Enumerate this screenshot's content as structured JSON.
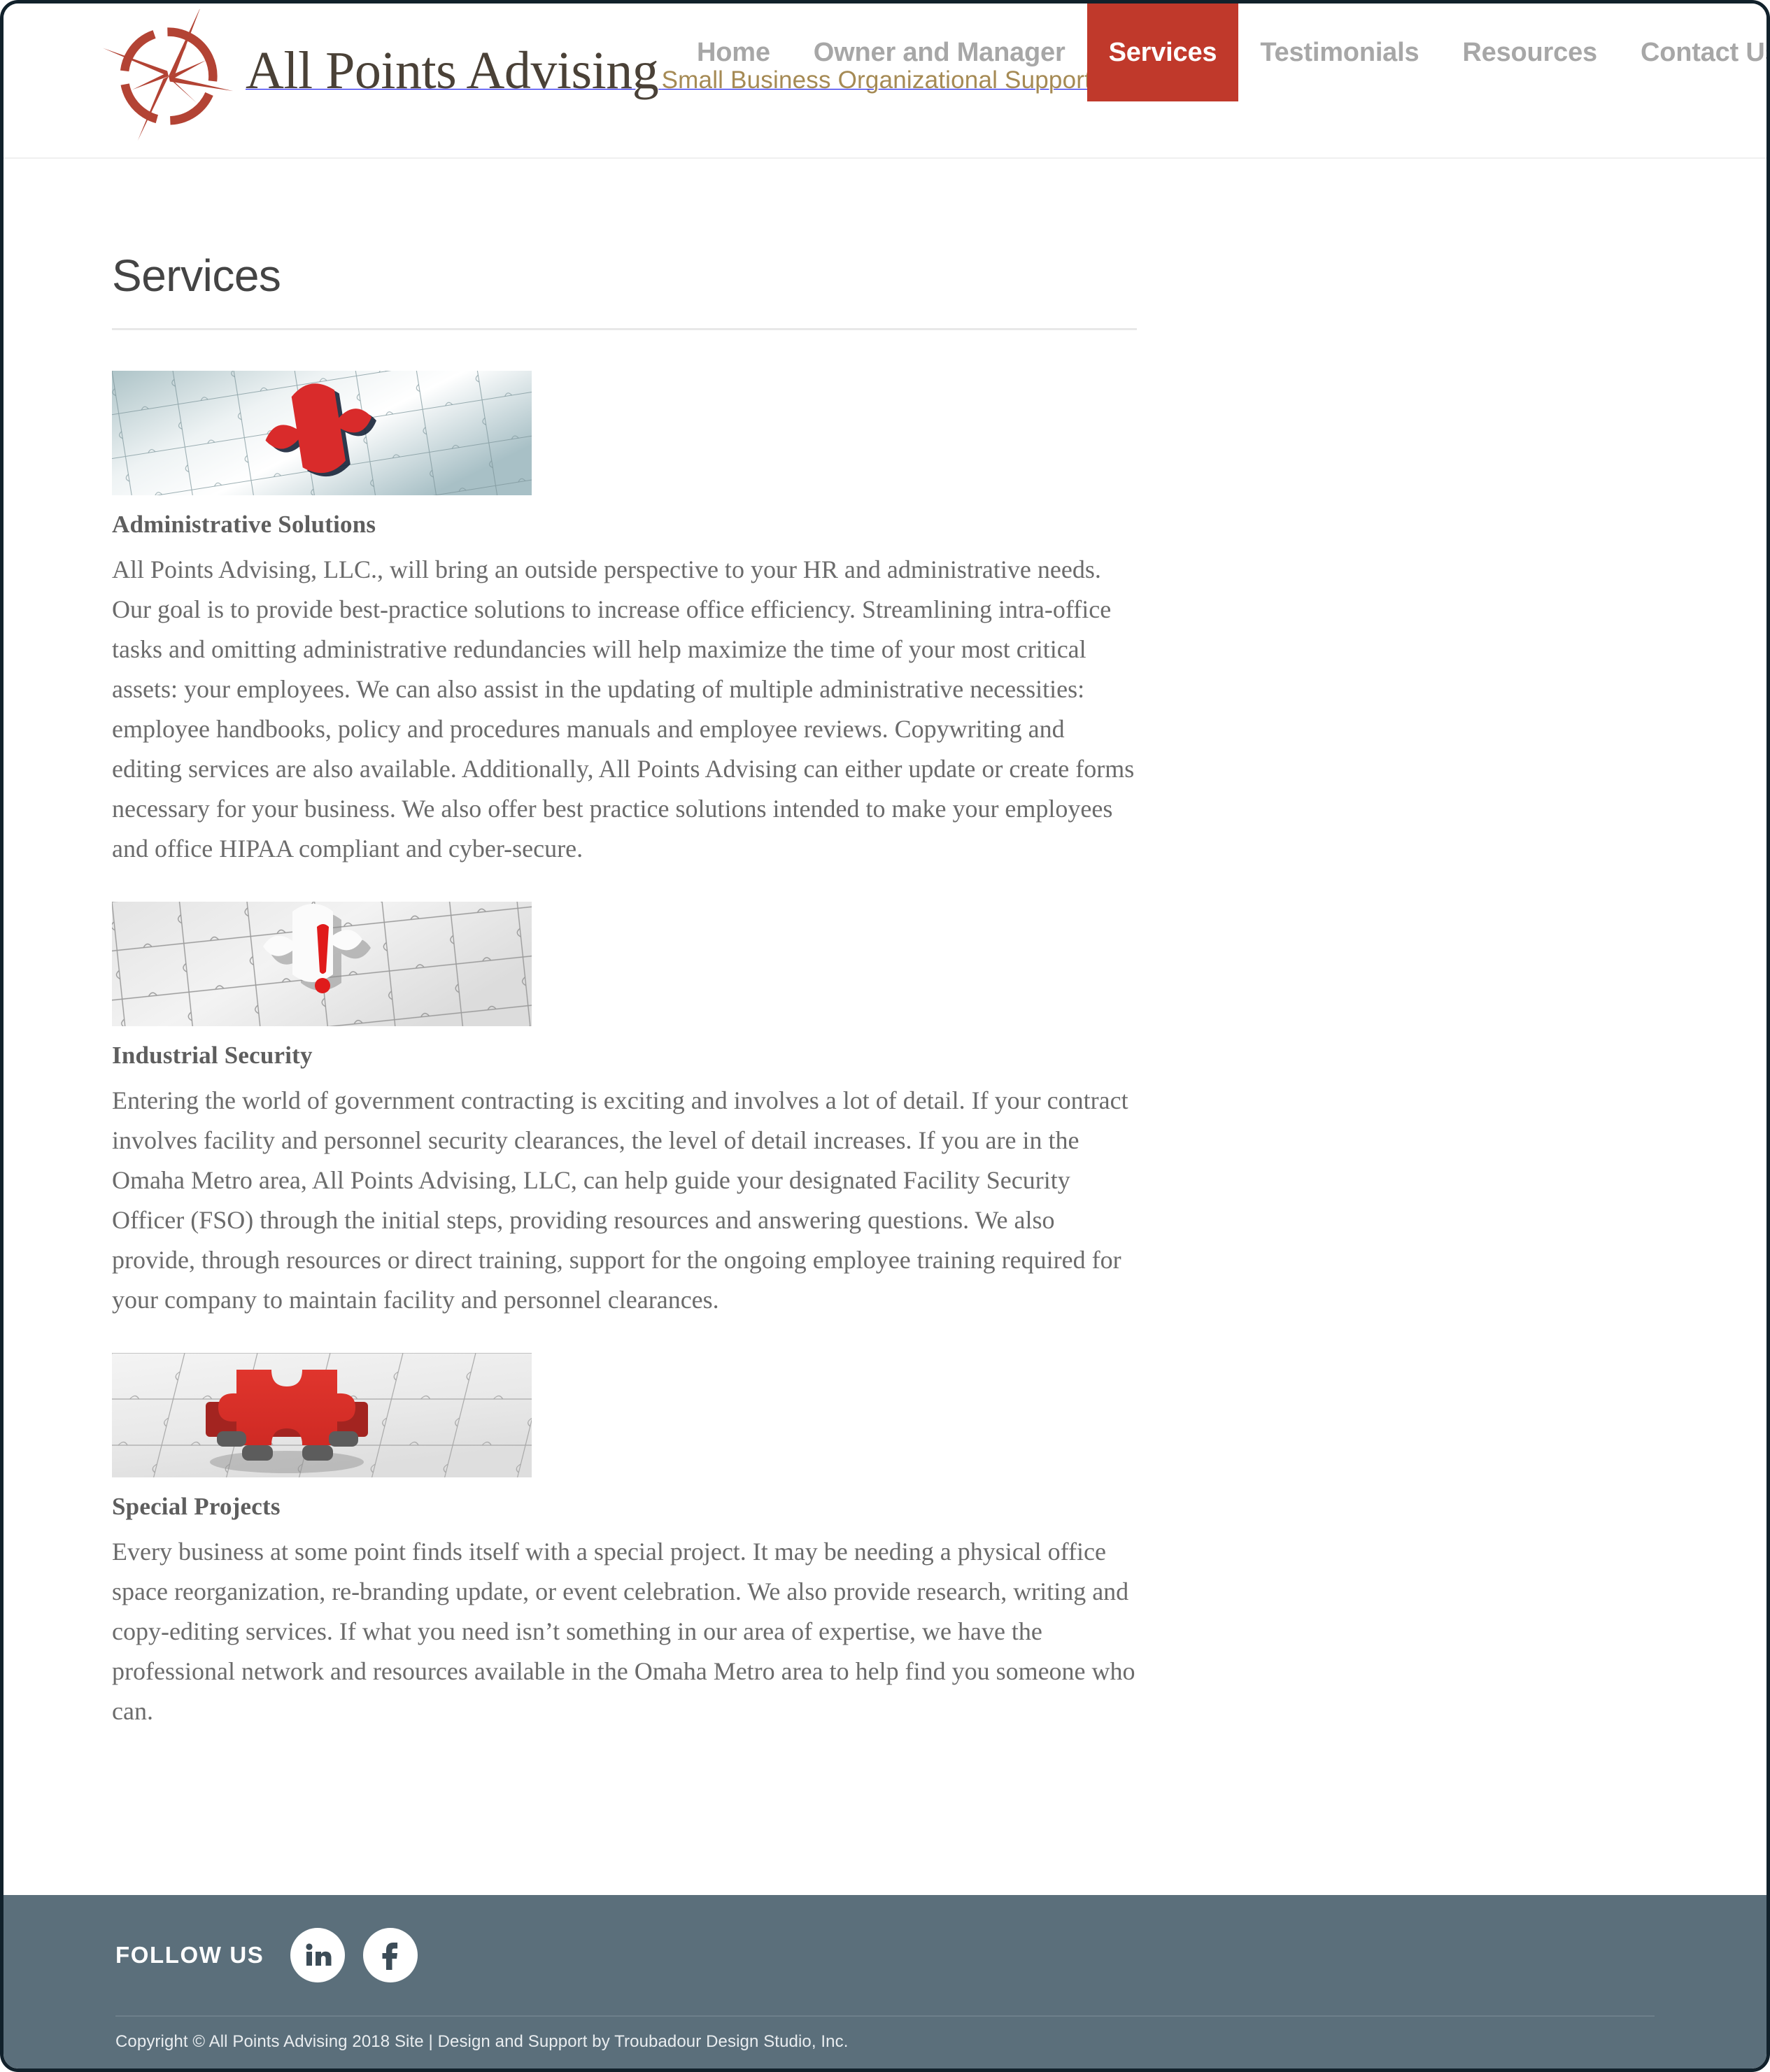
{
  "brand": {
    "logo_icon": "compass-rose-icon",
    "title": "All Points Advising",
    "tagline": "Small Business Organizational Support",
    "accent_color": "#c0392b",
    "tagline_color": "#a58a54"
  },
  "nav": {
    "items": [
      {
        "label": "Home",
        "active": false
      },
      {
        "label": "Owner and Manager",
        "active": false
      },
      {
        "label": "Services",
        "active": true
      },
      {
        "label": "Testimonials",
        "active": false
      },
      {
        "label": "Resources",
        "active": false
      },
      {
        "label": "Contact Us",
        "active": false
      }
    ]
  },
  "main": {
    "page_title": "Services",
    "services": [
      {
        "image_name": "puzzle-red-piece-blue-image",
        "heading": "Administrative Solutions",
        "body": "All Points Advising, LLC., will bring an outside perspective to your HR and administrative needs. Our goal is to provide best-practice solutions to increase office efficiency. Streamlining intra-office tasks and omitting administrative redundancies will help maximize the time of your most critical assets: your employees. We can also assist in the updating of multiple administrative necessities: employee handbooks, policy and procedures manuals and employee reviews. Copywriting and editing services are also available. Additionally, All Points Advising can either update or create  forms necessary for your business. We also offer best practice solutions intended to make your employees and office HIPAA compliant and cyber-secure."
      },
      {
        "image_name": "puzzle-exclamation-mark-image",
        "heading": "Industrial Security",
        "body": "Entering the world of government contracting is exciting and involves a lot of detail. If your contract involves facility and personnel security clearances, the level of detail increases. If you are in the Omaha Metro area, All Points Advising, LLC, can help guide your designated Facility Security Officer (FSO) through the initial steps, providing resources and answering questions. We also provide, through resources or direct training, support for the ongoing employee training required for your company to maintain facility and personnel clearances."
      },
      {
        "image_name": "puzzle-3d-red-piece-image",
        "heading": "Special Projects",
        "body": "Every business at some point finds itself with a special project. It may be needing a physical office space reorganization, re-branding update, or event celebration. We also provide research, writing and copy-editing services. If what you need isn’t something in our area of expertise, we have the professional network and resources available in the Omaha Metro area to help find you someone who can."
      }
    ]
  },
  "footer": {
    "follow_label": "FOLLOW US",
    "social": [
      {
        "name": "linkedin-icon",
        "glyph": "in"
      },
      {
        "name": "facebook-icon",
        "glyph": "f"
      }
    ],
    "copyright": "Copyright © All Points Advising 2018 Site | Design and Support by Troubadour Design Studio, Inc.",
    "background_color": "#5b6f7b"
  }
}
